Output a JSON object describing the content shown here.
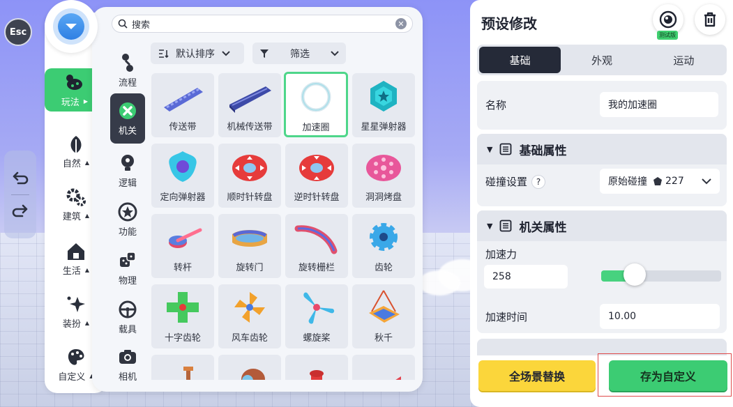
{
  "esc": {
    "label": "Esc"
  },
  "categories": [
    {
      "label": "玩法",
      "active": true,
      "icon": "dino-icon"
    },
    {
      "label": "自然",
      "icon": "leaf-icon"
    },
    {
      "label": "建筑",
      "icon": "gear-build-icon"
    },
    {
      "label": "生活",
      "icon": "house-icon"
    },
    {
      "label": "装扮",
      "icon": "sparkle-icon"
    },
    {
      "label": "自定义",
      "icon": "palette-icon"
    }
  ],
  "search": {
    "placeholder": "搜索"
  },
  "subcategories": [
    {
      "label": "流程",
      "icon": "flow-icon"
    },
    {
      "label": "机关",
      "active": true,
      "icon": "mechanism-icon"
    },
    {
      "label": "逻辑",
      "icon": "bulb-icon"
    },
    {
      "label": "功能",
      "icon": "star-circle-icon"
    },
    {
      "label": "物理",
      "icon": "dice-icon"
    },
    {
      "label": "载具",
      "icon": "steering-wheel-icon"
    },
    {
      "label": "相机",
      "icon": "camera-icon"
    }
  ],
  "sort": {
    "order_label": "默认排序",
    "filter_label": "筛选"
  },
  "items": [
    {
      "name": "传送带",
      "icon": "conveyor-icon"
    },
    {
      "name": "机械传送带",
      "icon": "mech-conveyor-icon"
    },
    {
      "name": "加速圈",
      "icon": "boost-ring-icon",
      "selected": true
    },
    {
      "name": "星星弹射器",
      "icon": "star-launcher-icon"
    },
    {
      "name": "定向弹射器",
      "icon": "directional-launcher-icon"
    },
    {
      "name": "顺时针转盘",
      "icon": "cw-turntable-icon"
    },
    {
      "name": "逆时针转盘",
      "icon": "ccw-turntable-icon"
    },
    {
      "name": "洞洞烤盘",
      "icon": "hole-plate-icon"
    },
    {
      "name": "转杆",
      "icon": "rotating-bar-icon"
    },
    {
      "name": "旋转门",
      "icon": "revolving-door-icon"
    },
    {
      "name": "旋转栅栏",
      "icon": "rotating-fence-icon"
    },
    {
      "name": "齿轮",
      "icon": "gear-icon"
    },
    {
      "name": "十字齿轮",
      "icon": "cross-gear-icon"
    },
    {
      "name": "风车齿轮",
      "icon": "windmill-gear-icon"
    },
    {
      "name": "螺旋桨",
      "icon": "propeller-icon"
    },
    {
      "name": "秋千",
      "icon": "swing-icon"
    }
  ],
  "panel": {
    "title": "预设修改",
    "test_badge": "测试版",
    "tabs": [
      {
        "label": "基础",
        "active": true
      },
      {
        "label": "外观"
      },
      {
        "label": "运动"
      }
    ],
    "name_label": "名称",
    "name_value": "我的加速圈",
    "basic_section": "基础属性",
    "collision_label": "碰撞设置",
    "collision_help": "?",
    "collision_value": "原始碰撞",
    "collision_count": "227",
    "mech_section": "机关属性",
    "accel_label": "加速力",
    "accel_value": "258",
    "accel_slider_fraction": 0.28,
    "time_label": "加速时间",
    "time_value": "10.00",
    "replace_label": "全场景替换",
    "save_label": "存为自定义"
  }
}
